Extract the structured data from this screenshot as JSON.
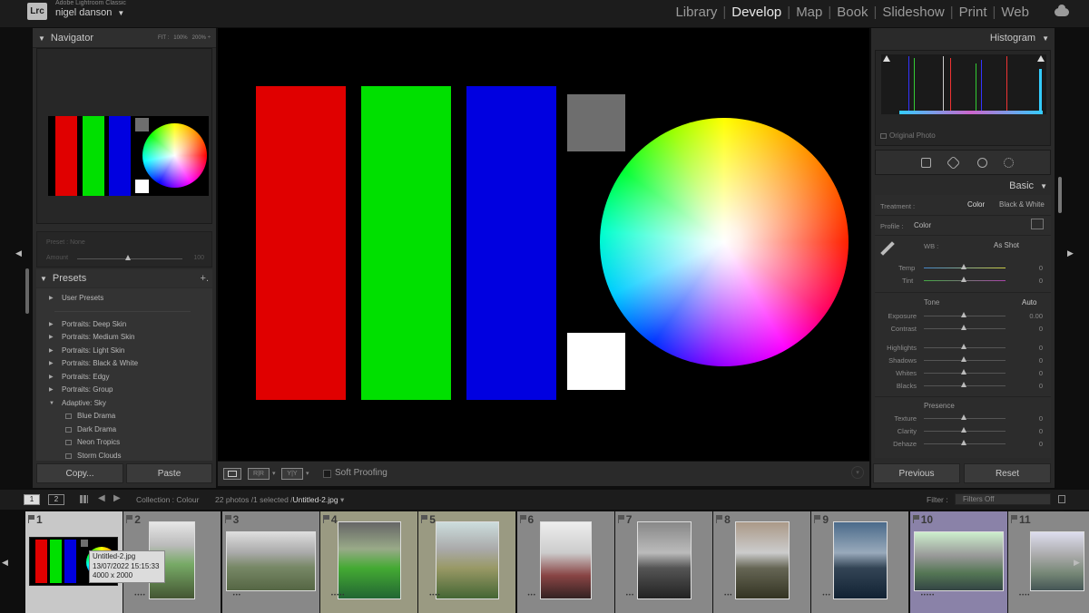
{
  "app": {
    "logo": "Lrc",
    "product": "Adobe Lightroom Classic",
    "user": "nigel danson"
  },
  "modules": [
    {
      "label": "Library",
      "active": false
    },
    {
      "label": "Develop",
      "active": true
    },
    {
      "label": "Map",
      "active": false
    },
    {
      "label": "Book",
      "active": false
    },
    {
      "label": "Slideshow",
      "active": false
    },
    {
      "label": "Print",
      "active": false
    },
    {
      "label": "Web",
      "active": false
    }
  ],
  "navigator": {
    "title": "Navigator",
    "zoom": [
      "FIT :",
      "100%",
      "200%"
    ]
  },
  "preset_amount": {
    "preset": "Preset : None",
    "amount": "Amount",
    "value": "100"
  },
  "presets": {
    "title": "Presets",
    "items": [
      {
        "label": "User Presets",
        "expanded": false,
        "child": false
      },
      {
        "label": "",
        "spacer": true
      },
      {
        "label": "Portraits: Deep Skin",
        "expanded": false,
        "child": false
      },
      {
        "label": "Portraits: Medium Skin",
        "expanded": false,
        "child": false
      },
      {
        "label": "Portraits: Light Skin",
        "expanded": false,
        "child": false
      },
      {
        "label": "Portraits: Black & White",
        "expanded": false,
        "child": false
      },
      {
        "label": "Portraits: Edgy",
        "expanded": false,
        "child": false
      },
      {
        "label": "Portraits: Group",
        "expanded": false,
        "child": false
      },
      {
        "label": "Adaptive: Sky",
        "expanded": true,
        "child": false
      },
      {
        "label": "Blue Drama",
        "child": true
      },
      {
        "label": "Dark Drama",
        "child": true
      },
      {
        "label": "Neon Tropics",
        "child": true
      },
      {
        "label": "Storm Clouds",
        "child": true
      }
    ]
  },
  "left_buttons": {
    "copy": "Copy...",
    "paste": "Paste"
  },
  "toolbar": {
    "soft_proofing": "Soft Proofing"
  },
  "histogram": {
    "title": "Histogram",
    "original_photo": "Original Photo"
  },
  "basic": {
    "title": "Basic",
    "treatment_label": "Treatment :",
    "treatment_color": "Color",
    "treatment_bw": "Black & White",
    "profile_label": "Profile :",
    "profile_value": "Color",
    "wb_label": "WB :",
    "wb_value": "As Shot",
    "temp": {
      "label": "Temp",
      "value": "0"
    },
    "tint": {
      "label": "Tint",
      "value": "0"
    },
    "tone_label": "Tone",
    "auto_label": "Auto",
    "tone_sliders": [
      {
        "label": "Exposure",
        "value": "0.00"
      },
      {
        "label": "Contrast",
        "value": "0"
      },
      {
        "label": "Highlights",
        "value": "0"
      },
      {
        "label": "Shadows",
        "value": "0"
      },
      {
        "label": "Whites",
        "value": "0"
      },
      {
        "label": "Blacks",
        "value": "0"
      }
    ],
    "presence_label": "Presence",
    "presence_sliders": [
      {
        "label": "Texture",
        "value": "0"
      },
      {
        "label": "Clarity",
        "value": "0"
      },
      {
        "label": "Dehaze",
        "value": "0"
      }
    ]
  },
  "right_buttons": {
    "previous": "Previous",
    "reset": "Reset"
  },
  "filmbar": {
    "view1": "1",
    "view2": "2",
    "collection": "Collection : Colour",
    "count": "22 photos /1 selected /",
    "filename": "Untitled-2.jpg",
    "filter_label": "Filter :",
    "filter_value": "Filters Off"
  },
  "filmstrip": [
    {
      "num": "1",
      "stars": "",
      "selected": true
    },
    {
      "num": "2",
      "stars": "••••"
    },
    {
      "num": "3",
      "stars": "•••"
    },
    {
      "num": "4",
      "stars": "•••••"
    },
    {
      "num": "5",
      "stars": "••••"
    },
    {
      "num": "6",
      "stars": "•••"
    },
    {
      "num": "7",
      "stars": "•••"
    },
    {
      "num": "8",
      "stars": "•••"
    },
    {
      "num": "9",
      "stars": "•••"
    },
    {
      "num": "10",
      "stars": "•••••"
    },
    {
      "num": "11",
      "stars": "••••"
    }
  ],
  "tooltip": {
    "line1": "Untitled-2.jpg",
    "line2": "13/07/2022 15:15:33",
    "line3": "4000 x 2000"
  },
  "colors": {
    "red": "#e00000",
    "green": "#00e000",
    "blue": "#0000e0",
    "gray": "#6e6e6e",
    "white": "#ffffff"
  }
}
